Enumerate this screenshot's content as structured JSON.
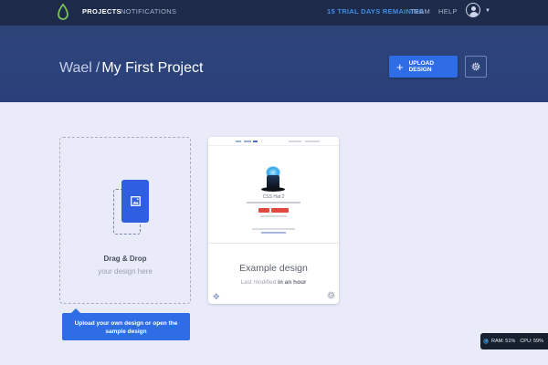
{
  "nav": {
    "projects": "PROJECTS",
    "notifications": "NOTIFICATIONS",
    "trial": "15 TRIAL DAYS REMAINING",
    "team": "TEAM",
    "help": "HELP"
  },
  "header": {
    "owner": "Wael",
    "separator": "/",
    "project": "My First Project",
    "upload_label": "UPLOAD DESIGN"
  },
  "dropzone": {
    "title": "Drag & Drop",
    "subtitle": "your design here"
  },
  "tooltip": {
    "text": "Upload your own design or open the sample design"
  },
  "example_card": {
    "preview_title": "CSS Hat 2",
    "title": "Example design",
    "meta_prefix": "Last modified",
    "meta_time": "in an hour"
  },
  "status_widget": {
    "ram": "RAM: 51%",
    "cpu": "CPU: 59%"
  },
  "colors": {
    "nav_bg": "#1e2a4a",
    "header_bg": "#2d4479",
    "accent": "#2f6de6",
    "trial": "#3f8ee8",
    "page_bg": "#e9ecf8"
  },
  "icons": {
    "logo": "leaf-drop-icon",
    "upload": "plus-icon",
    "settings": "gear-icon",
    "avatar": "user-icon",
    "dropzone": "image-icon",
    "card_move": "move-icon",
    "card_settings": "gear-icon"
  }
}
